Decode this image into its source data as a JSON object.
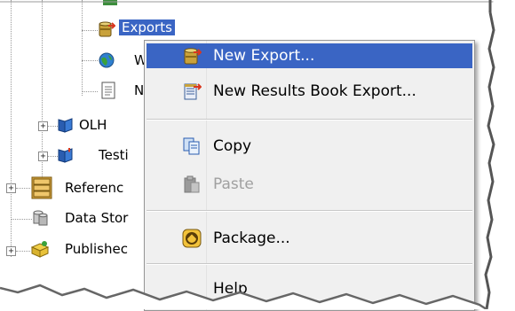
{
  "tree": {
    "exports_label": "Exports",
    "item_w_label": "W",
    "item_n_label": "N",
    "olh_label": "OLH",
    "testing_label": "Testi",
    "reference_label": "Referenc",
    "data_store_label": "Data Stor",
    "published_label": "Publishec"
  },
  "context_menu": {
    "items": [
      {
        "label": "New Export...",
        "icon": "new-export-icon",
        "highlighted": true
      },
      {
        "label": "New Results Book Export...",
        "icon": "results-book-export-icon"
      },
      {
        "label": "Copy",
        "icon": "copy-icon"
      },
      {
        "label": "Paste",
        "icon": "paste-icon",
        "disabled": true
      },
      {
        "label": "Package...",
        "icon": "package-icon"
      },
      {
        "label": "Help",
        "icon": "help-icon"
      }
    ]
  },
  "colors": {
    "selection": "#3a65c4",
    "menu_background": "#f0f0f0"
  }
}
